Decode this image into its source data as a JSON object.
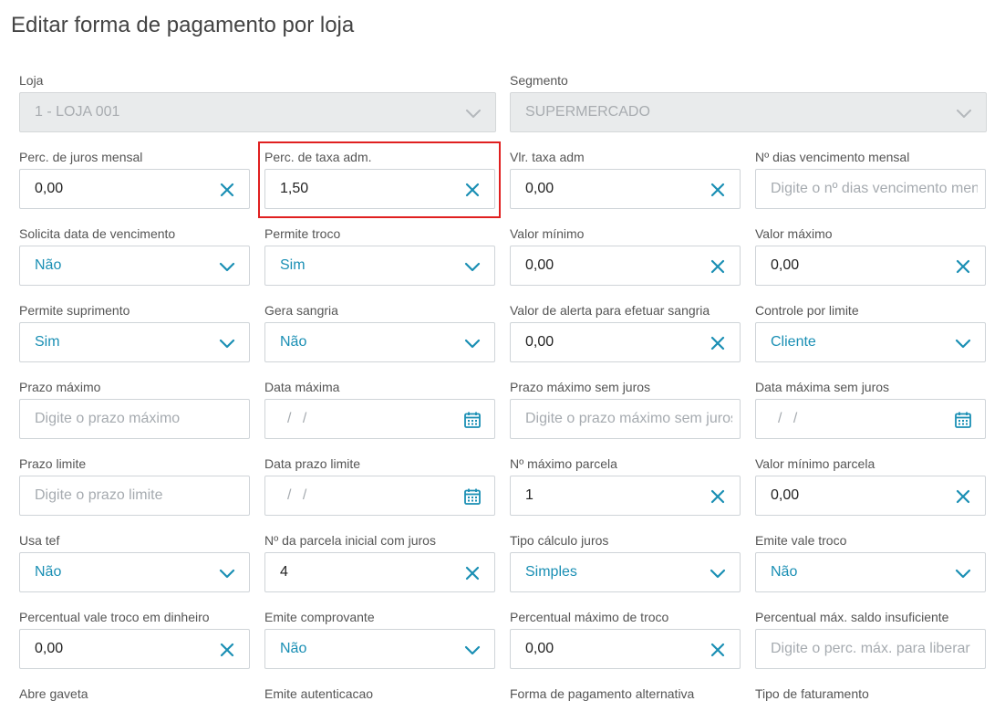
{
  "page": {
    "title": "Editar forma de pagamento por loja"
  },
  "colors": {
    "accent": "#1a8fb4",
    "highlight": "#e02020"
  },
  "fields": [
    {
      "label": "Loja",
      "value": "1 - LOJA 001",
      "kind": "select-disabled"
    },
    {
      "label": "Segmento",
      "value": "SUPERMERCADO",
      "kind": "select-disabled"
    },
    {
      "label": "Perc. de juros mensal",
      "value": "0,00",
      "kind": "input-clear"
    },
    {
      "label": "Perc. de taxa adm.",
      "value": "1,50",
      "kind": "input-clear"
    },
    {
      "label": "Vlr. taxa adm",
      "value": "0,00",
      "kind": "input-clear"
    },
    {
      "label": "Nº dias vencimento mensal",
      "placeholder": "Digite o nº dias vencimento mensal",
      "kind": "input-placeholder"
    },
    {
      "label": "Solicita data de vencimento",
      "value": "Não",
      "kind": "select"
    },
    {
      "label": "Permite troco",
      "value": "Sim",
      "kind": "select"
    },
    {
      "label": "Valor mínimo",
      "value": "0,00",
      "kind": "input-clear"
    },
    {
      "label": "Valor máximo",
      "value": "0,00",
      "kind": "input-clear"
    },
    {
      "label": "Permite suprimento",
      "value": "Sim",
      "kind": "select"
    },
    {
      "label": "Gera sangria",
      "value": "Não",
      "kind": "select"
    },
    {
      "label": "Valor de alerta para efetuar sangria",
      "value": "0,00",
      "kind": "input-clear"
    },
    {
      "label": "Controle por limite",
      "value": "Cliente",
      "kind": "select"
    },
    {
      "label": "Prazo máximo",
      "placeholder": "Digite o prazo máximo",
      "kind": "input-placeholder"
    },
    {
      "label": "Data máxima",
      "value": "/ /",
      "kind": "date"
    },
    {
      "label": "Prazo máximo sem juros",
      "placeholder": "Digite o prazo máximo sem juros",
      "kind": "input-placeholder"
    },
    {
      "label": "Data máxima sem juros",
      "value": "/ /",
      "kind": "date"
    },
    {
      "label": "Prazo limite",
      "placeholder": "Digite o prazo limite",
      "kind": "input-placeholder"
    },
    {
      "label": "Data prazo limite",
      "value": "/ /",
      "kind": "date"
    },
    {
      "label": "Nº máximo parcela",
      "value": "1",
      "kind": "input-clear"
    },
    {
      "label": "Valor mínimo parcela",
      "value": "0,00",
      "kind": "input-clear"
    },
    {
      "label": "Usa tef",
      "value": "Não",
      "kind": "select"
    },
    {
      "label": "Nº da parcela inicial com juros",
      "value": "4",
      "kind": "input-clear"
    },
    {
      "label": "Tipo cálculo juros",
      "value": "Simples",
      "kind": "select"
    },
    {
      "label": "Emite vale troco",
      "value": "Não",
      "kind": "select"
    },
    {
      "label": "Percentual vale troco em dinheiro",
      "value": "0,00",
      "kind": "input-clear"
    },
    {
      "label": "Emite comprovante",
      "value": "Não",
      "kind": "select"
    },
    {
      "label": "Percentual máximo de troco",
      "value": "0,00",
      "kind": "input-clear"
    },
    {
      "label": "Percentual máx. saldo insuficiente",
      "placeholder": "Digite o perc. máx. para liberar",
      "kind": "input-placeholder"
    },
    {
      "label": "Abre gaveta",
      "kind": "label-only"
    },
    {
      "label": "Emite autenticacao",
      "kind": "label-only"
    },
    {
      "label": "Forma de pagamento alternativa",
      "kind": "label-only"
    },
    {
      "label": "Tipo de faturamento",
      "kind": "label-only"
    }
  ]
}
